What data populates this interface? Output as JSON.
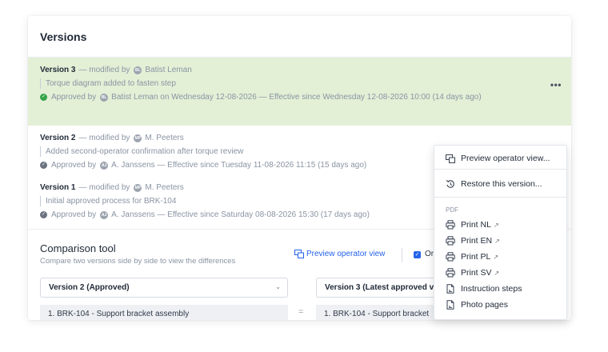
{
  "header": {
    "title": "Versions"
  },
  "versions": [
    {
      "label": "Version 3",
      "modified_prefix": "— modified by",
      "author_initials": "BL",
      "author": "Batist Leman",
      "description": "Torque diagram added to fasten step",
      "approved_prefix": "Approved by",
      "approver_initials": "BL",
      "approval_text": "Batist Leman on Wednesday 12-08-2026 — Effective since Wednesday 12-08-2026 10:00 (14 days ago)",
      "more": "•••"
    },
    {
      "label": "Version 2",
      "modified_prefix": "— modified by",
      "author_initials": "MP",
      "author": "M. Peeters",
      "description": "Added second-operator confirmation after torque review",
      "approved_prefix": "Approved by",
      "approver_initials": "AJ",
      "approval_text": "A. Janssens — Effective since Tuesday 11-08-2026 11:15 (15 days ago)",
      "more": "•••"
    },
    {
      "label": "Version 1",
      "modified_prefix": "— modified by",
      "author_initials": "MP",
      "author": "M. Peeters",
      "description": "Initial approved process for BRK-104",
      "approved_prefix": "Approved by",
      "approver_initials": "AJ",
      "approval_text": "A. Janssens — Effective since Saturday 08-08-2026 15:30 (17 days ago)"
    }
  ],
  "comparison": {
    "title": "Comparison tool",
    "subtitle": "Compare two versions side by side to view the differences",
    "preview_link": "Preview operator view",
    "checkbox_label": "Or",
    "left_select": "Version 2 (Approved)",
    "right_select": "Version 3 (Latest approved v",
    "left_step": "1.  BRK-104 - Support bracket assembly",
    "right_step": "1.  BRK-104 - Support bracket",
    "equals": "="
  },
  "menu": {
    "preview": "Preview operator view...",
    "restore": "Restore this version...",
    "pdf_heading": "PDF",
    "print_nl": "Print NL",
    "print_en": "Print EN",
    "print_pl": "Print PL",
    "print_sv": "Print SV",
    "instruction_steps": "Instruction steps",
    "photo_pages": "Photo pages"
  },
  "colors": {
    "approved_row_bg": "#e3f0d6",
    "accent": "#2563eb",
    "approved_check": "#34a34a"
  }
}
